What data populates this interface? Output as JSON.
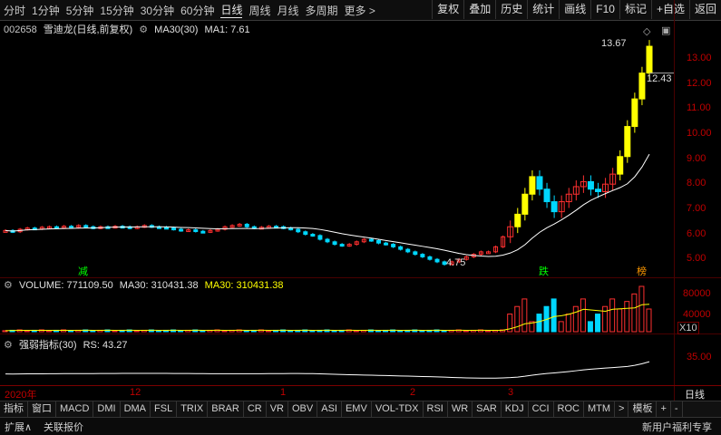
{
  "periods": [
    "分时",
    "1分钟",
    "5分钟",
    "15分钟",
    "30分钟",
    "60分钟",
    "日线",
    "周线",
    "月线",
    "多周期",
    "更多 >"
  ],
  "active_period": "日线",
  "tools": [
    "复权",
    "叠加",
    "历史",
    "统计",
    "画线",
    "F10",
    "标记",
    "+自选",
    "返回"
  ],
  "stock": {
    "code": "002658",
    "name": "雪迪龙(日线,前复权)",
    "ma_label": "MA30(30)",
    "ma_value": "MA1: 7.61"
  },
  "price_axis": [
    "13.00",
    "12.00",
    "11.00",
    "10.00",
    "9.00",
    "8.00",
    "7.00",
    "6.00",
    "5.00"
  ],
  "annotations": {
    "high": "13.67",
    "last": "12.43",
    "low": "4.75",
    "events": [
      "减",
      "跌",
      "榜"
    ]
  },
  "volume": {
    "label": "VOLUME: 771109.50",
    "ma30a": "MA30: 310431.38",
    "ma30b": "MA30: 310431.38",
    "axis": [
      "80000",
      "40000"
    ],
    "unit": "X10"
  },
  "rs": {
    "label": "强弱指标(30)",
    "value": "RS: 43.27",
    "axis": "35.00"
  },
  "date_axis": [
    "2020年",
    "12",
    "1",
    "2",
    "3"
  ],
  "date_axis_right": "日线",
  "indicators": [
    "指标",
    "窗口",
    "MACD",
    "DMI",
    "DMA",
    "FSL",
    "TRIX",
    "BRAR",
    "CR",
    "VR",
    "OBV",
    "ASI",
    "EMV",
    "VOL-TDX",
    "RSI",
    "WR",
    "SAR",
    "KDJ",
    "CCI",
    "ROC",
    "MTM",
    ">",
    "模板",
    "+",
    "-"
  ],
  "bottom": {
    "expand": "扩展∧",
    "related": "关联报价",
    "promo": "新用户福利专享"
  },
  "colors": {
    "up": "#ff3030",
    "down": "#00d7ff",
    "ma": "#ffffff",
    "limit": "#ffff00"
  },
  "chart_data": {
    "type": "candlestick",
    "y_range": [
      4.5,
      13.9
    ],
    "prices": [
      6.15,
      6.1,
      6.2,
      6.25,
      6.22,
      6.28,
      6.3,
      6.26,
      6.32,
      6.28,
      6.35,
      6.3,
      6.25,
      6.3,
      6.28,
      6.32,
      6.3,
      6.25,
      6.3,
      6.35,
      6.3,
      6.28,
      6.25,
      6.2,
      6.15,
      6.18,
      6.12,
      6.1,
      6.15,
      6.2,
      6.3,
      6.35,
      6.4,
      6.3,
      6.25,
      6.28,
      6.32,
      6.3,
      6.25,
      6.2,
      6.1,
      6.0,
      5.95,
      5.8,
      5.7,
      5.6,
      5.55,
      5.6,
      5.7,
      5.8,
      5.75,
      5.65,
      5.6,
      5.5,
      5.4,
      5.3,
      5.2,
      5.1,
      5.0,
      4.9,
      4.8,
      4.9,
      5.0,
      5.1,
      5.2,
      5.3,
      5.3,
      5.5,
      5.9,
      6.3,
      6.8,
      7.6,
      8.3,
      7.8,
      7.3,
      6.9,
      7.3,
      7.6,
      7.9,
      8.1,
      7.8,
      7.7,
      8.0,
      8.4,
      9.1,
      10.3,
      11.4,
      12.43,
      13.5
    ]
  }
}
